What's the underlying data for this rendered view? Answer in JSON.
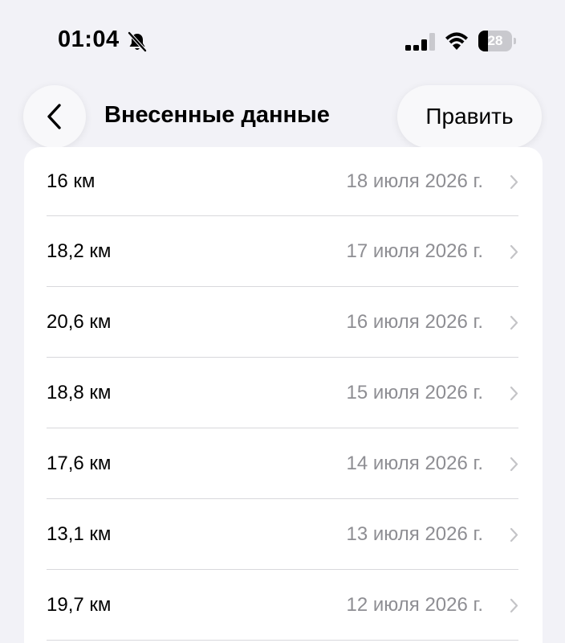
{
  "status_bar": {
    "time": "01:04",
    "battery_level": "28",
    "icons": [
      "bell-slash-icon",
      "cellular-signal-icon",
      "wifi-icon",
      "battery-icon"
    ]
  },
  "nav": {
    "title": "Внесенные данные",
    "edit_label": "Править",
    "back_icon": "chevron-left-icon"
  },
  "entries": [
    {
      "value": "16 км",
      "date": "18 июля 2026 г."
    },
    {
      "value": "18,2 км",
      "date": "17 июля 2026 г."
    },
    {
      "value": "20,6 км",
      "date": "16 июля 2026 г."
    },
    {
      "value": "18,8 км",
      "date": "15 июля 2026 г."
    },
    {
      "value": "17,6 км",
      "date": "14 июля 2026 г."
    },
    {
      "value": "13,1 км",
      "date": "13 июля 2026 г."
    },
    {
      "value": "19,7 км",
      "date": "12 июля 2026 г."
    }
  ],
  "colors": {
    "background": "#f2f2f7",
    "secondary_text": "#8e8e93",
    "chevron": "#c4c4c7"
  }
}
